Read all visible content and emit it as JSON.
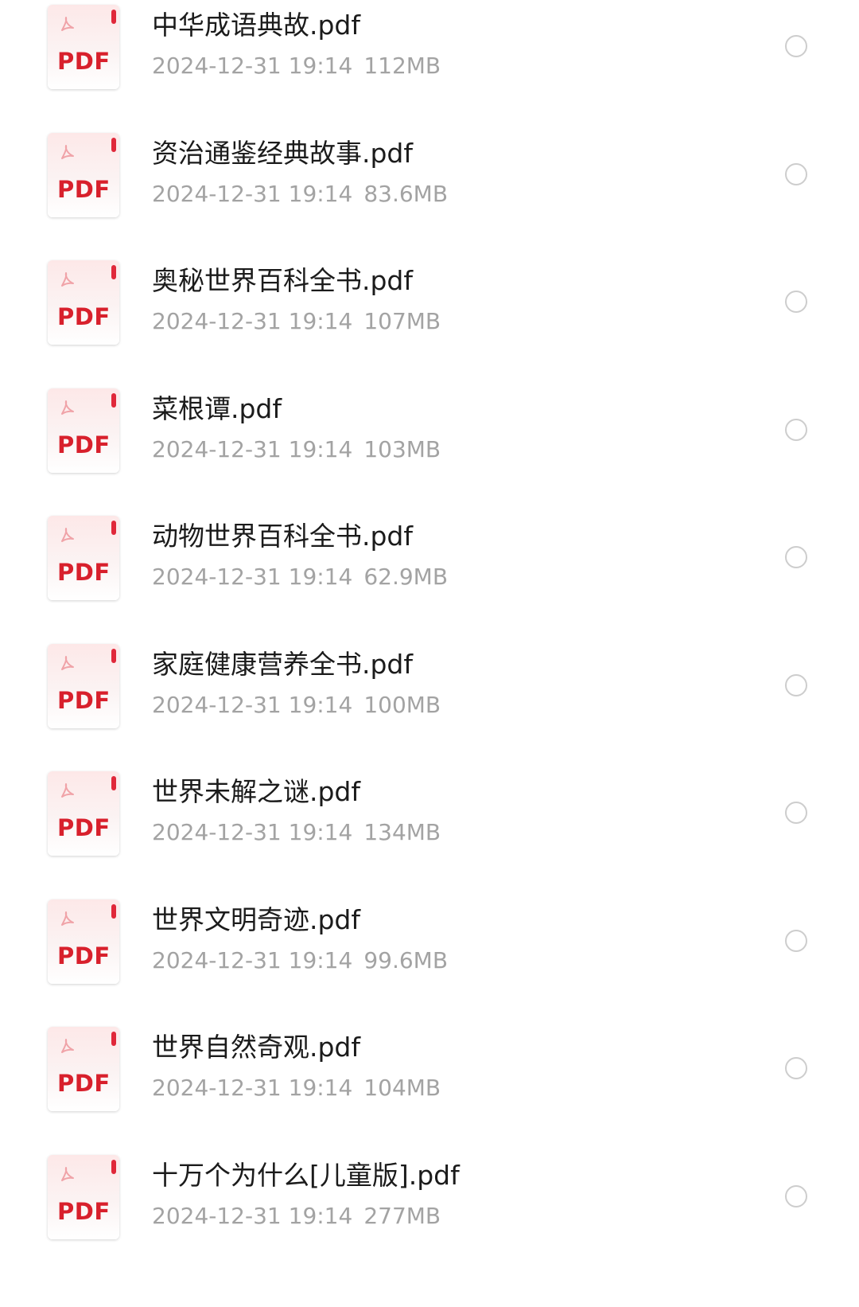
{
  "files": [
    {
      "name": "中华成语典故.pdf",
      "date": "2024-12-31 19:14",
      "size": "112MB",
      "type_label": "PDF",
      "icon": "pdf-file-icon",
      "selected": false
    },
    {
      "name": "资治通鉴经典故事.pdf",
      "date": "2024-12-31 19:14",
      "size": "83.6MB",
      "type_label": "PDF",
      "icon": "pdf-file-icon",
      "selected": false
    },
    {
      "name": "奥秘世界百科全书.pdf",
      "date": "2024-12-31 19:14",
      "size": "107MB",
      "type_label": "PDF",
      "icon": "pdf-file-icon",
      "selected": false
    },
    {
      "name": "菜根谭.pdf",
      "date": "2024-12-31 19:14",
      "size": "103MB",
      "type_label": "PDF",
      "icon": "pdf-file-icon",
      "selected": false
    },
    {
      "name": "动物世界百科全书.pdf",
      "date": "2024-12-31 19:14",
      "size": "62.9MB",
      "type_label": "PDF",
      "icon": "pdf-file-icon",
      "selected": false
    },
    {
      "name": "家庭健康营养全书.pdf",
      "date": "2024-12-31 19:14",
      "size": "100MB",
      "type_label": "PDF",
      "icon": "pdf-file-icon",
      "selected": false
    },
    {
      "name": "世界未解之谜.pdf",
      "date": "2024-12-31 19:14",
      "size": "134MB",
      "type_label": "PDF",
      "icon": "pdf-file-icon",
      "selected": false
    },
    {
      "name": "世界文明奇迹.pdf",
      "date": "2024-12-31 19:14",
      "size": "99.6MB",
      "type_label": "PDF",
      "icon": "pdf-file-icon",
      "selected": false
    },
    {
      "name": "世界自然奇观.pdf",
      "date": "2024-12-31 19:14",
      "size": "104MB",
      "type_label": "PDF",
      "icon": "pdf-file-icon",
      "selected": false
    },
    {
      "name": "十万个为什么[儿童版].pdf",
      "date": "2024-12-31 19:14",
      "size": "277MB",
      "type_label": "PDF",
      "icon": "pdf-file-icon",
      "selected": false
    }
  ],
  "colors": {
    "pdf_red": "#d8202c",
    "name_text": "#1b1b1b",
    "meta_text": "#a3a3a3",
    "radio_border": "#cdcdcd"
  }
}
